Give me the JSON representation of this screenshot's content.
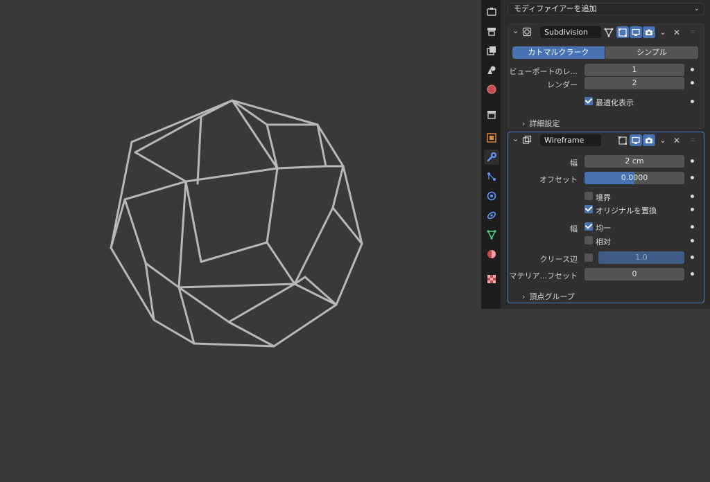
{
  "panel": {
    "add_modifier": "モディファイアーを追加"
  },
  "subdivision": {
    "name": "Subdivision",
    "mode_catmull": "カトマルクラーク",
    "mode_simple": "シンプル",
    "viewport_label": "ビューポートのレ...",
    "viewport_value": "1",
    "render_label": "レンダー",
    "render_value": "2",
    "optimal_display": "最適化表示",
    "advanced": "詳細設定"
  },
  "wireframe": {
    "name": "Wireframe",
    "thickness_label": "幅",
    "thickness_value": "2 cm",
    "offset_label": "オフセット",
    "offset_value": "0.0000",
    "boundary": "境界",
    "replace_original": "オリジナルを置換",
    "even_label": "幅",
    "even": "均一",
    "relative": "相対",
    "crease_label": "クリース辺",
    "crease_value": "1.0",
    "material_offset_label": "マテリア...フセット",
    "material_offset_value": "0",
    "vertex_group": "頂点グループ"
  },
  "colors": {
    "accent": "#4772b3",
    "active_outline": "#4f7fc5"
  },
  "icons": {
    "tabs": [
      "tool-icon",
      "render-icon",
      "output-icon",
      "view-layer-icon",
      "scene-icon",
      "world-icon",
      "collection-icon",
      "object-icon",
      "modifier-wrench-icon",
      "particles-icon",
      "physics-icon",
      "constraints-icon",
      "data-icon",
      "material-icon",
      "texture-icon"
    ]
  }
}
